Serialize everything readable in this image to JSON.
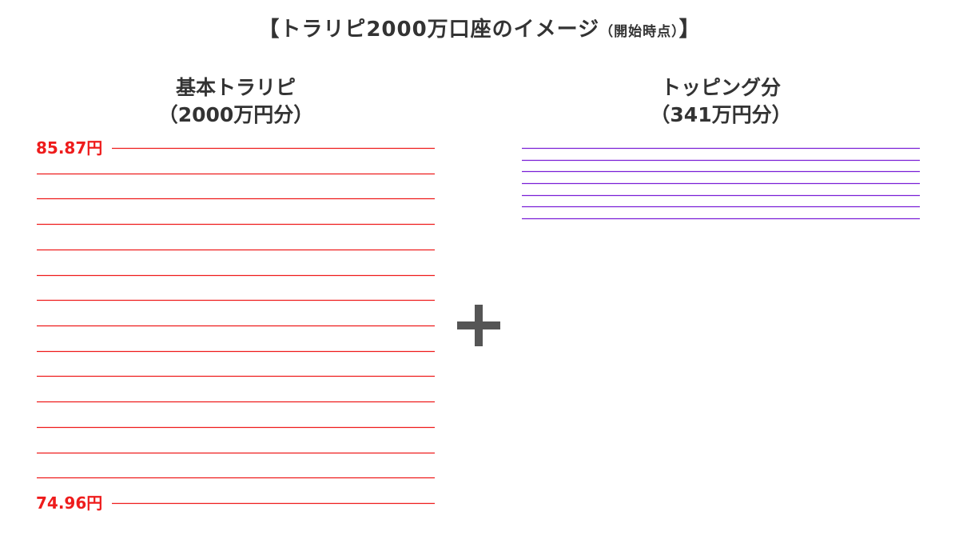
{
  "title": {
    "main": "【トラリピ2000万口座のイメージ",
    "note": "（開始時点）",
    "close": "】"
  },
  "left_panel": {
    "heading_line1": "基本トラリピ",
    "heading_line2": "（2000万円分）",
    "top_price_label": "85.87円",
    "bottom_price_label": "74.96円",
    "line_count": 15,
    "line_color": "#ee1c1c"
  },
  "operator": {
    "icon": "plus-icon",
    "color": "#555555"
  },
  "right_panel": {
    "heading_line1": "トッピング分",
    "heading_line2": "（341万円分）",
    "line_count": 7,
    "line_color": "#7a1fd6"
  },
  "colors": {
    "label_red": "#ee1c1c",
    "text": "#333333"
  }
}
